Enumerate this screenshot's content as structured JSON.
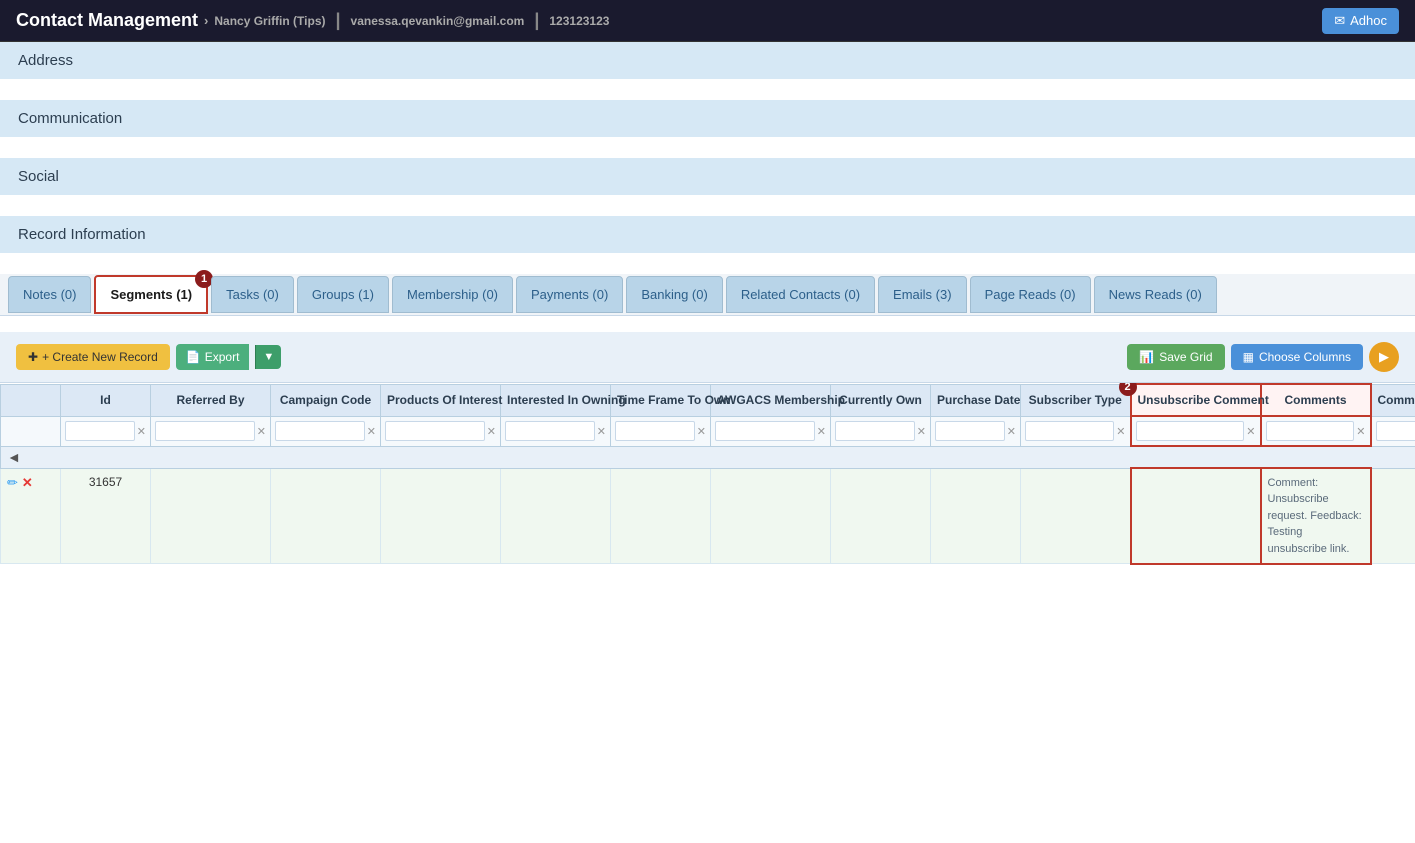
{
  "header": {
    "title": "Contact Management",
    "breadcrumb": "Nancy Griffin (Tips)",
    "email": "vanessa.qevankin@gmail.com",
    "phone": "123123123",
    "adhoc_label": "Adhoc"
  },
  "sections": [
    {
      "id": "address",
      "label": "Address"
    },
    {
      "id": "communication",
      "label": "Communication"
    },
    {
      "id": "social",
      "label": "Social"
    },
    {
      "id": "record-information",
      "label": "Record Information"
    }
  ],
  "tabs": [
    {
      "id": "notes",
      "label": "Notes (0)",
      "active": false
    },
    {
      "id": "segments",
      "label": "Segments (1)",
      "active": true,
      "badge": "1"
    },
    {
      "id": "tasks",
      "label": "Tasks (0)",
      "active": false
    },
    {
      "id": "groups",
      "label": "Groups (1)",
      "active": false
    },
    {
      "id": "membership",
      "label": "Membership (0)",
      "active": false
    },
    {
      "id": "payments",
      "label": "Payments (0)",
      "active": false
    },
    {
      "id": "banking",
      "label": "Banking (0)",
      "active": false
    },
    {
      "id": "related-contacts",
      "label": "Related Contacts (0)",
      "active": false
    },
    {
      "id": "emails",
      "label": "Emails (3)",
      "active": false
    },
    {
      "id": "page-reads",
      "label": "Page Reads (0)",
      "active": false
    },
    {
      "id": "news-reads",
      "label": "News Reads (0)",
      "active": false
    }
  ],
  "toolbar": {
    "create_label": "+ Create New Record",
    "export_label": "Export",
    "save_grid_label": "Save Grid",
    "choose_columns_label": "Choose Columns"
  },
  "grid": {
    "columns": [
      {
        "id": "actions",
        "label": ""
      },
      {
        "id": "id",
        "label": "Id"
      },
      {
        "id": "referred-by",
        "label": "Referred By"
      },
      {
        "id": "campaign-code",
        "label": "Campaign Code"
      },
      {
        "id": "products-of-interest",
        "label": "Products Of Interest"
      },
      {
        "id": "interested-in-owning",
        "label": "Interested In Owning"
      },
      {
        "id": "time-frame",
        "label": "Time Frame To Own"
      },
      {
        "id": "awgacs",
        "label": "AWGACS Membership"
      },
      {
        "id": "currently-own",
        "label": "Currently Own"
      },
      {
        "id": "purchase-date",
        "label": "Purchase Date"
      },
      {
        "id": "subscriber-type",
        "label": "Subscriber Type"
      },
      {
        "id": "unsubscribe-comment",
        "label": "Unsubscribe Comment"
      },
      {
        "id": "comments",
        "label": "Comments"
      },
      {
        "id": "comm-date",
        "label": "Comm Date"
      }
    ],
    "rows": [
      {
        "id_val": "31657",
        "referred_by": "",
        "campaign_code": "",
        "products_of_interest": "",
        "interested_in_owning": "",
        "time_frame": "",
        "awgacs": "",
        "currently_own": "",
        "purchase_date": "",
        "subscriber_type": "",
        "unsubscribe_comment": "",
        "comments": "Comment: Unsubscribe request. Feedback: Testing unsubscribe link.",
        "comm_date": ""
      }
    ],
    "badge2_label": "2"
  }
}
